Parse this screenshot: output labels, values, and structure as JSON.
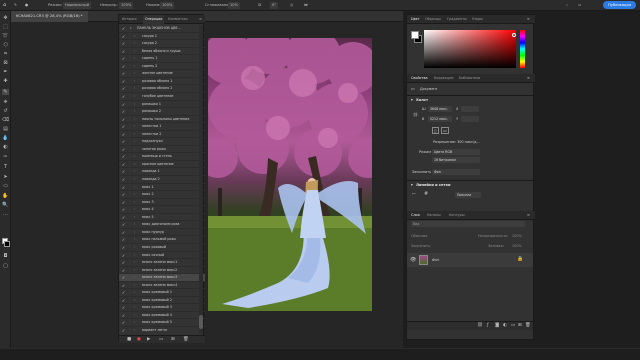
{
  "options_bar": {
    "mode_label": "Режим:",
    "mode_value": "Нормальный",
    "opacity_label": "Непрозр.:",
    "opacity_value": "100%",
    "flow_label": "Нажим:",
    "flow_value": "100%",
    "smoothing_label": "Сглаживание:",
    "smoothing_value": "10%",
    "angle_value": "0°",
    "publish_label": "Публикация"
  },
  "document": {
    "tab_title": "6C9A0621.CR3 @ 28,4% (RGB/16) *"
  },
  "actions_panel": {
    "tabs": [
      "История",
      "Операции",
      "Комментар"
    ],
    "active_tab": "Операции",
    "items": [
      "ПАНЕЛЬ ЭКШЕНОВ ЦВЕ...",
      "сакура 1",
      "сакура 2",
      "белая яблоня и груша",
      "сирень 1",
      "сирень 2",
      "желтое цветение",
      "розовая яблоня 1",
      "розовая яблоня 2",
      "голубое цветение",
      "ромашки 1",
      "ромашки 2",
      "пионы тюльпаны цветение",
      "лепестки 1",
      "лепестки 2",
      "подсолнухи",
      "золотая рожь",
      "пшеница и степь",
      "красное цветение",
      "лаванда 1",
      "лаванда 2",
      "микс 1",
      "микс 2",
      "микс 3",
      "микс 4",
      "микс 5",
      "микс диагоналм роза",
      "микс пурпур",
      "микс пальмой розы",
      "микс розовый",
      "микс сочный",
      "много зелени микс1",
      "много зелени микс2",
      "много зелени микс3",
      "много зелени микс4",
      "микс кремовый 1",
      "микс кремовый 2",
      "микс кремовый 3",
      "микс кремовый 4",
      "микс кремовый 5",
      "вариант легче"
    ],
    "selected_index": 33
  },
  "color_panel": {
    "tabs": [
      "Цвет",
      "Образцы",
      "Градиенты",
      "Узоры"
    ],
    "active_tab": "Цвет",
    "fg_color": "#ffffff",
    "bg_color": "#000000"
  },
  "properties_panel": {
    "tabs": [
      "Свойства",
      "Коррекция",
      "Библиотеки"
    ],
    "active_tab": "Свойства",
    "doc_label": "Документ",
    "canvas_section": "Холст",
    "width_label": "Ш",
    "width_value": "3648 пикс.",
    "x_label": "X",
    "height_label": "В",
    "height_value": "5212 пикс.",
    "y_label": "Y",
    "resolution_label": "Разрешение: 300 пикс/д...",
    "mode_label": "Режим",
    "mode_value": "Цвета RGB",
    "depth_value": "16 бит/канал",
    "fill_label": "Заполнить",
    "fill_value": "Фон",
    "rulers_section": "Линейки и сетки",
    "rulers_unit": "Пиксели"
  },
  "layers_panel": {
    "tabs": [
      "Слои",
      "Каналы",
      "Контуры"
    ],
    "active_tab": "Слои",
    "search_placeholder": "Вид",
    "blend_value": "Обычные",
    "opacity_label": "Непрозрачность:",
    "opacity_value": "100%",
    "lock_label": "Закрепить:",
    "fill_label": "Заливка:",
    "fill_value": "100%",
    "layer_name": "Фон"
  }
}
